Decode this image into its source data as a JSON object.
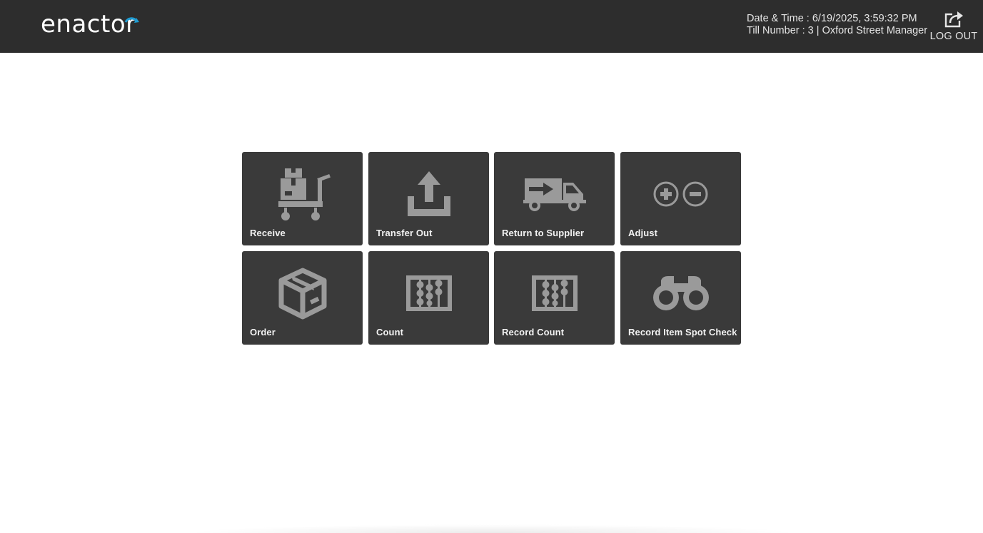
{
  "app": {
    "brand": "enactor"
  },
  "header": {
    "datetime_label": "Date & Time : 6/19/2025, 3:59:32 PM",
    "till_label": "Till Number : 3",
    "separator": "|",
    "user_label": "Oxford Street Manager",
    "logout_label": "LOG OUT",
    "logout_icon": "share-out-icon"
  },
  "colors": {
    "topbar": "#2d2d2d",
    "tile": "#3a3a3a",
    "icon": "#9a9a9a",
    "accent": "#1f9bd1"
  },
  "tiles": [
    {
      "label": "Receive",
      "icon": "trolley-boxes-icon"
    },
    {
      "label": "Transfer Out",
      "icon": "upload-icon"
    },
    {
      "label": "Return to Supplier",
      "icon": "delivery-truck-icon"
    },
    {
      "label": "Adjust",
      "icon": "plus-minus-icon"
    },
    {
      "label": "Order",
      "icon": "package-box-icon"
    },
    {
      "label": "Count",
      "icon": "abacus-icon"
    },
    {
      "label": "Record Count",
      "icon": "abacus-icon"
    },
    {
      "label": "Record Item Spot Check",
      "icon": "binoculars-icon"
    }
  ]
}
